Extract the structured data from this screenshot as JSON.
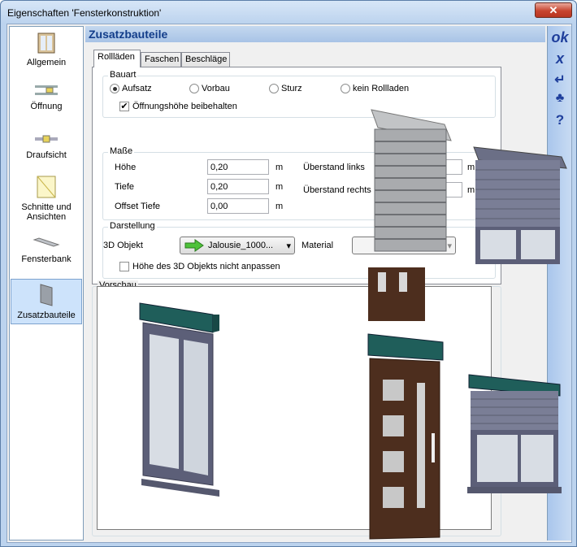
{
  "window": {
    "title": "Eigenschaften 'Fensterkonstruktion'",
    "close_label": "✕"
  },
  "nav": {
    "items": [
      {
        "label": "Allgemein",
        "icon": "window-icon"
      },
      {
        "label": "Öffnung",
        "icon": "opening-icon"
      },
      {
        "label": "Draufsicht",
        "icon": "topview-icon"
      },
      {
        "label": "Schnitte und Ansichten",
        "icon": "section-icon"
      },
      {
        "label": "Fensterbank",
        "icon": "sill-icon"
      },
      {
        "label": "Zusatzbauteile",
        "icon": "addon-icon"
      }
    ],
    "active": "Zusatzbauteile"
  },
  "heading": "Zusatzbauteile",
  "tabs": [
    "Rollläden",
    "Faschen",
    "Beschläge"
  ],
  "bauart": {
    "label": "Bauart",
    "options": [
      "Aufsatz",
      "Vorbau",
      "Sturz",
      "kein Rollladen"
    ],
    "selected": "Aufsatz",
    "keep_height_label": "Öffnungshöhe beibehalten",
    "keep_height_checked": "✔"
  },
  "masse": {
    "label": "Maße",
    "hoehe_label": "Höhe",
    "hoehe_value": "0,20",
    "tiefe_label": "Tiefe",
    "tiefe_value": "0,20",
    "offset_label": "Offset Tiefe",
    "offset_value": "0,00",
    "unit": "m",
    "ueberstand_links": "Überstand links",
    "ueberstand_rechts": "Überstand rechts"
  },
  "darstellung": {
    "label": "Darstellung",
    "obj_label": "3D Objekt",
    "obj_value": "Jalousie_1000...",
    "material_label": "Material",
    "adapt_label": "Höhe des 3D Objekts nicht anpassen"
  },
  "vorschau": {
    "label": "Vorschau"
  },
  "toolbar": {
    "ok": "ok",
    "cancel": "x",
    "apply": "↵",
    "hint": "♣",
    "help": "?"
  },
  "colors": {
    "accent": "#123d8a",
    "frame": "#5c5f78",
    "door": "#4d2e1e",
    "teal": "#1f5e5a"
  }
}
